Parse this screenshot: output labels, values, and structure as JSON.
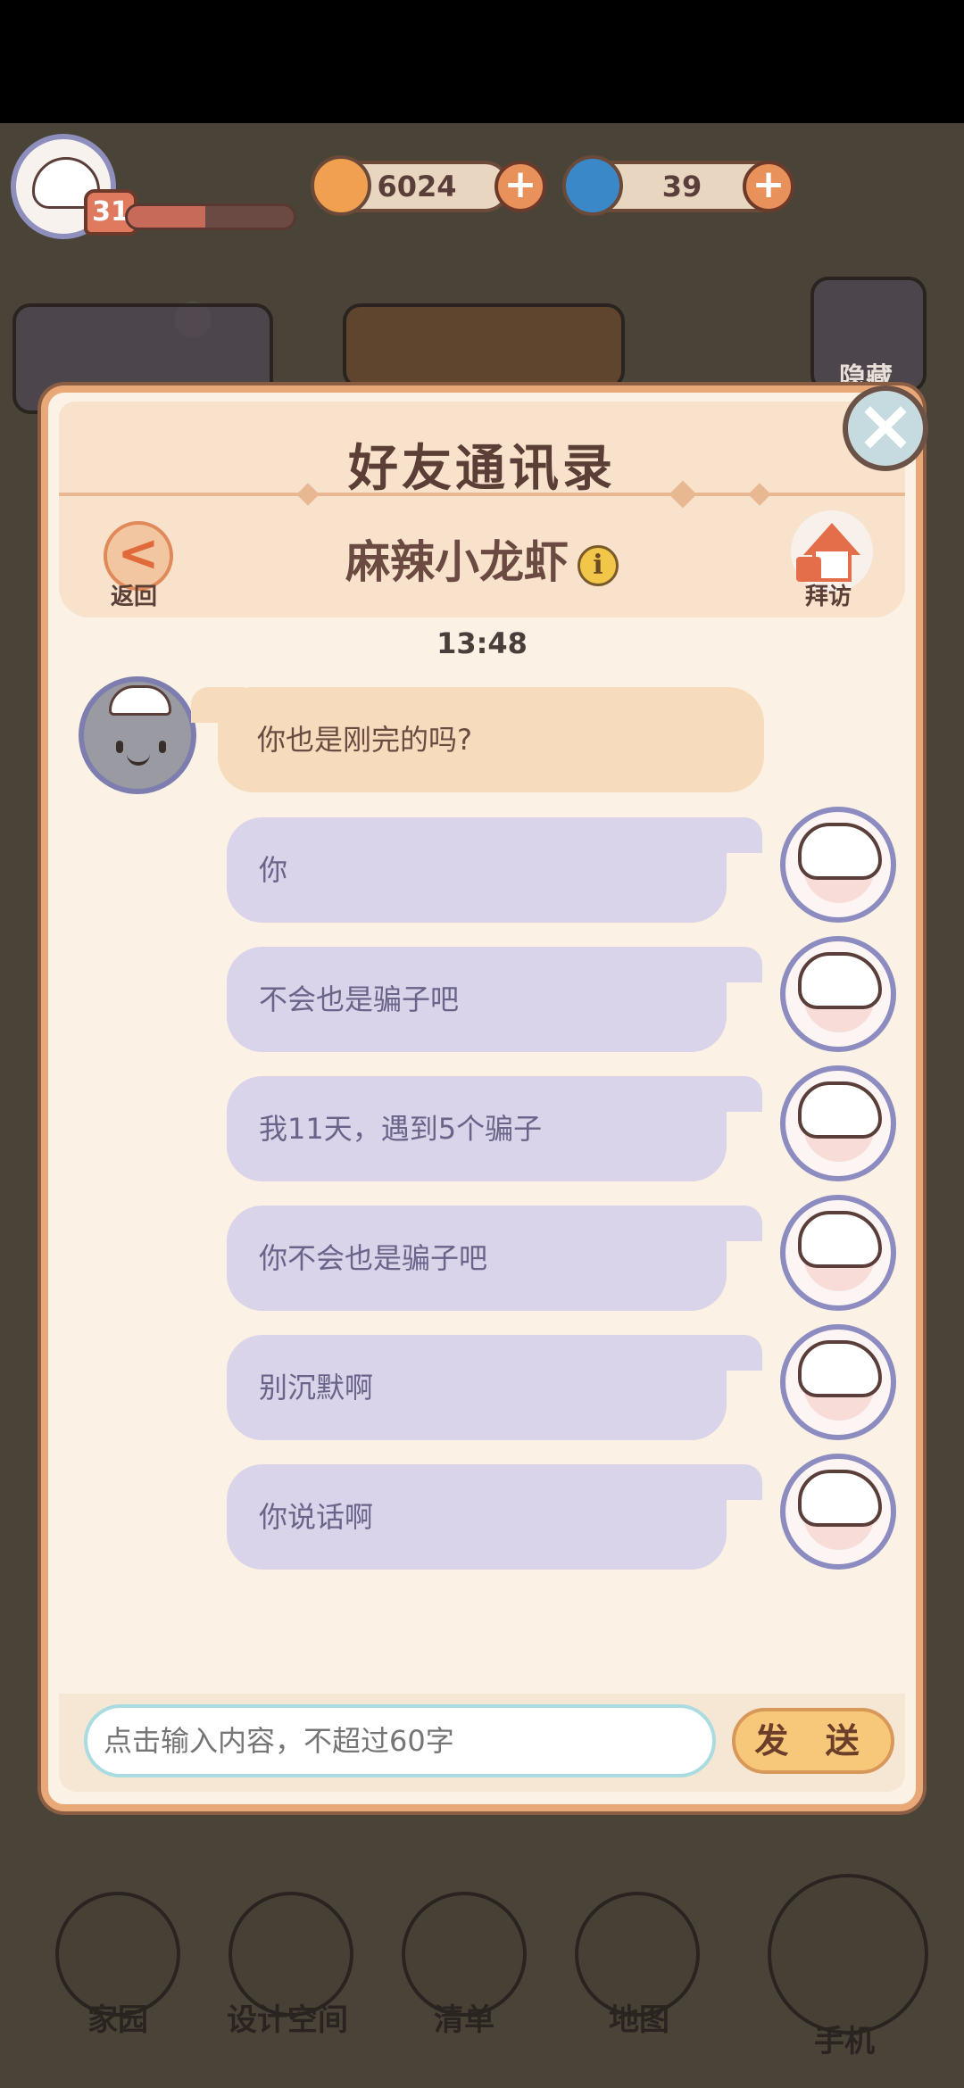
{
  "hud": {
    "level": "31",
    "xp_fraction": 0.47,
    "coins": "6024",
    "gems": "39",
    "plus": "+"
  },
  "dialog": {
    "title": "好友通讯录",
    "back_label": "返回",
    "back_icon": "<",
    "contact_name": "麻辣小龙虾",
    "info_icon": "i",
    "visit_label": "拜访",
    "timestamp": "13:48",
    "incoming_message": "你也是刚完的吗?",
    "outgoing_messages": [
      "你",
      "不会也是骗子吧",
      "我11天，遇到5个骗子",
      "你不会也是骗子吧",
      "别沉默啊",
      "你说话啊"
    ],
    "input_placeholder": "点击输入内容，不超过60字",
    "send_label": "发 送",
    "close_icon": "×"
  },
  "bottom_nav": {
    "items": [
      "家园",
      "设计空间",
      "清单",
      "地图",
      "手机"
    ]
  },
  "background": {
    "hidden_label": "隐藏"
  }
}
